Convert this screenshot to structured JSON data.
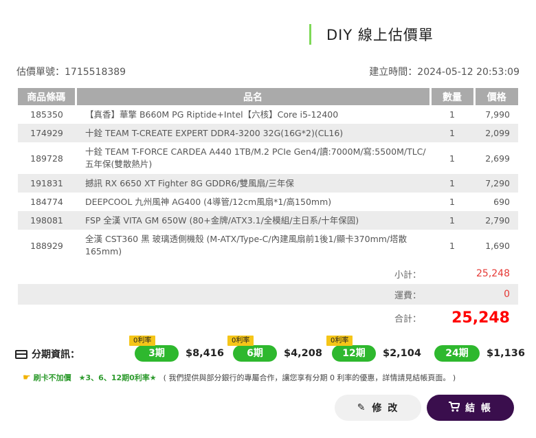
{
  "header": {
    "title": "DIY 線上估價單"
  },
  "meta": {
    "quote_label": "估價單號：1715518389",
    "created_label": "建立時間：2024-05-12 20:53:09"
  },
  "table": {
    "headers": [
      "商品條碼",
      "品名",
      "數量",
      "價格"
    ],
    "rows": [
      {
        "code": "185350",
        "name": "【真香】華擎 B660M PG Riptide+Intel【六核】Core i5-12400",
        "qty": "1",
        "price": "7,990"
      },
      {
        "code": "174929",
        "name": "十銓 TEAM T-CREATE EXPERT DDR4-3200 32G(16G*2)(CL16)",
        "qty": "1",
        "price": "2,099"
      },
      {
        "code": "189728",
        "name": "十銓 TEAM T-FORCE CARDEA A440 1TB/M.2 PCIe Gen4/讀:7000M/寫:5500M/TLC/五年保(雙散熱片)",
        "qty": "1",
        "price": "2,699"
      },
      {
        "code": "191831",
        "name": "撼訊 RX 6650 XT Fighter 8G GDDR6/雙風扇/三年保",
        "qty": "1",
        "price": "7,290"
      },
      {
        "code": "184774",
        "name": "DEEPCOOL 九州風神 AG400 (4導管/12cm風扇*1/高150mm)",
        "qty": "1",
        "price": "690"
      },
      {
        "code": "198081",
        "name": "FSP 全漢 VITA GM 650W (80+金牌/ATX3.1/全模組/主日系/十年保固)",
        "qty": "1",
        "price": "2,790"
      },
      {
        "code": "188929",
        "name": "全漢 CST360 黑 玻璃透側機殼 (M-ATX/Type-C/內建風扇前1後1/顯卡370mm/塔散165mm)",
        "qty": "1",
        "price": "1,690"
      }
    ]
  },
  "summary": {
    "subtotal_label": "小計：",
    "subtotal": "25,248",
    "shipping_label": "運費：",
    "shipping": "0",
    "total_label": "合計：",
    "total": "25,248"
  },
  "installment": {
    "label": "分期資訊：",
    "plans": [
      {
        "tag": "0利率",
        "period": "3期",
        "amount": "$8,416"
      },
      {
        "tag": "0利率",
        "period": "6期",
        "amount": "$4,208"
      },
      {
        "tag": "0利率",
        "period": "12期",
        "amount": "$2,104"
      },
      {
        "tag": "",
        "period": "24期",
        "amount": "$1,136"
      }
    ]
  },
  "note": {
    "highlight": "刷卡不加價　★3、6、12期0利率★",
    "text": "( 我們提供與部分銀行的專屬合作，讓您享有分期 0 利率的優惠，詳情請見結帳頁面。 )"
  },
  "buttons": {
    "edit": "修 改",
    "checkout": "結 帳"
  },
  "colors": {
    "accent_green": "#2eb82e",
    "price_red": "#e53935",
    "checkout_bg": "#3a0e4d",
    "tag_yellow": "#f5c518"
  },
  "icons": {
    "card": "credit-card-icon",
    "hand": "pointing-hand-icon",
    "pencil": "pencil-icon",
    "cart": "cart-icon"
  }
}
